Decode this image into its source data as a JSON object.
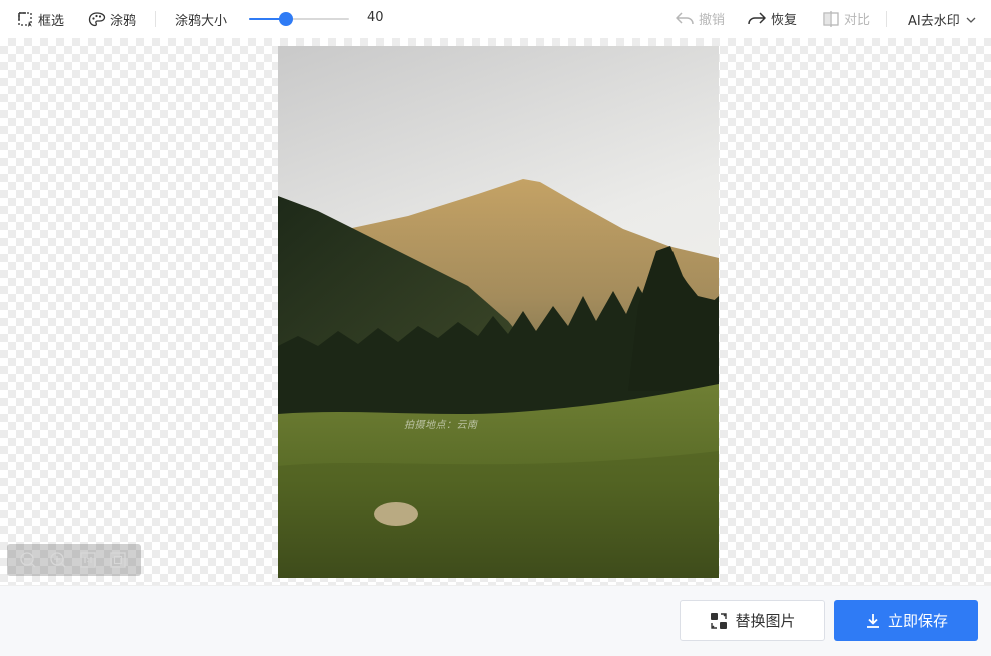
{
  "toolbar": {
    "select_label": "框选",
    "brush_label": "涂鸦",
    "brush_size_label": "涂鸦大小",
    "brush_size_value": "40",
    "brush_size_fraction": 0.37,
    "undo_label": "撤销",
    "redo_label": "恢复",
    "compare_label": "对比",
    "mode_label": "AI去水印",
    "icons": [
      "select-rect-icon",
      "brush-icon",
      "undo-icon",
      "redo-icon",
      "compare-icon",
      "chevron-down-icon"
    ]
  },
  "canvas": {
    "watermark_text": "拍摄地点：云南",
    "zoom_controls": [
      "zoom-out-icon",
      "zoom-in-icon",
      "actual-size-icon",
      "fit-screen-icon"
    ]
  },
  "actions": {
    "replace_label": "替换图片",
    "save_label": "立即保存"
  },
  "colors": {
    "accent": "#2f7bf5",
    "disabled_text": "#b7b7b7"
  }
}
